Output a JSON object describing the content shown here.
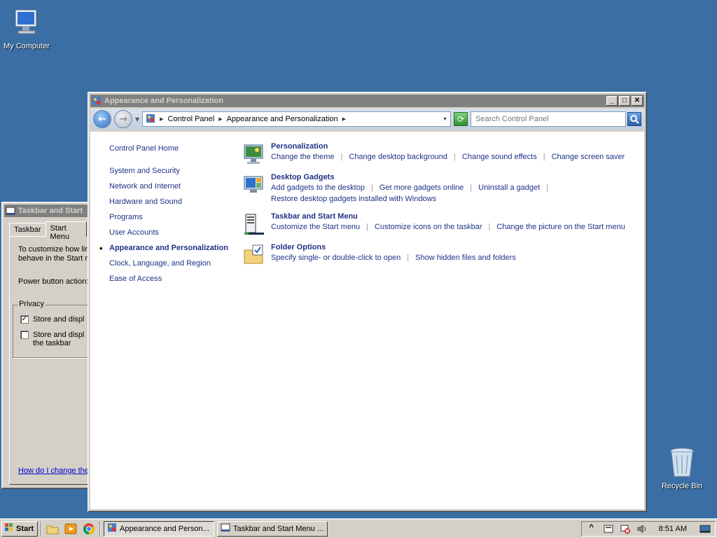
{
  "desktop": {
    "icons": {
      "my_computer": "My Computer",
      "recycle_bin": "Recycle Bin"
    }
  },
  "control_panel": {
    "title": "Appearance and Personalization",
    "address": {
      "crumbs": [
        "Control Panel",
        "Appearance and Personalization"
      ]
    },
    "search_placeholder": "Search Control Panel",
    "left_nav": {
      "home": "Control Panel Home",
      "items": [
        "System and Security",
        "Network and Internet",
        "Hardware and Sound",
        "Programs",
        "User Accounts",
        "Appearance and Personalization",
        "Clock, Language, and Region",
        "Ease of Access"
      ]
    },
    "tasks": [
      {
        "heading": "Personalization",
        "links": [
          "Change the theme",
          "Change desktop background",
          "Change sound effects",
          "Change screen saver"
        ]
      },
      {
        "heading": "Desktop Gadgets",
        "links": [
          "Add gadgets to the desktop",
          "Get more gadgets online",
          "Uninstall a gadget"
        ],
        "links2": [
          "Restore desktop gadgets installed with Windows"
        ]
      },
      {
        "heading": "Taskbar and Start Menu",
        "links": [
          "Customize the Start menu",
          "Customize icons on the taskbar",
          "Change the picture on the Start menu"
        ]
      },
      {
        "heading": "Folder Options",
        "links": [
          "Specify single- or double-click to open",
          "Show hidden files and folders"
        ]
      }
    ]
  },
  "taskbar_props": {
    "title": "Taskbar and Start",
    "tabs": [
      "Taskbar",
      "Start Menu"
    ],
    "intro_line1": "To customize how linl",
    "intro_line2": "behave in the Start r",
    "power_label": "Power button action:",
    "privacy_legend": "Privacy",
    "check1_label": "Store and displ",
    "check1_checked": true,
    "check2_label_line1": "Store and displ",
    "check2_label_line2": "the taskbar",
    "check2_checked": false,
    "help_link": "How do I change the"
  },
  "taskbar": {
    "start_label": "Start",
    "buttons": [
      "Appearance and Person...",
      "Taskbar and Start Menu ..."
    ],
    "clock": "8:51 AM"
  }
}
